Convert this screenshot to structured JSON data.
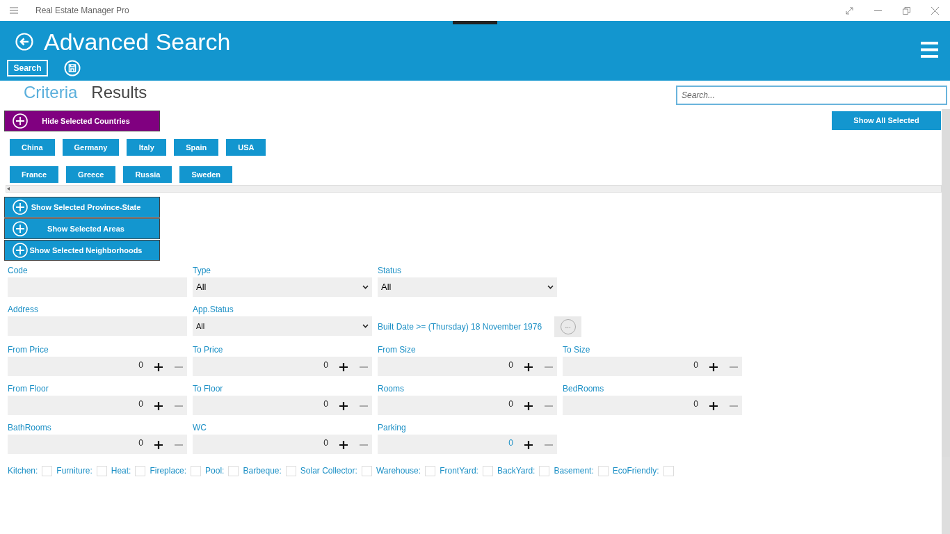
{
  "window": {
    "title": "Real Estate Manager Pro"
  },
  "header": {
    "title": "Advanced Search",
    "search_button": "Search"
  },
  "tabs": [
    {
      "label": "Criteria",
      "selected": true
    },
    {
      "label": "Results",
      "selected": false
    }
  ],
  "search": {
    "placeholder": "Search..."
  },
  "show_all_button": "Show All Selected",
  "country_toggle": {
    "label": "Hide Selected Countries",
    "expanded": true
  },
  "countries": [
    [
      "China",
      "Germany",
      "Italy",
      "Spain",
      "USA"
    ],
    [
      "France",
      "Greece",
      "Russia",
      "Sweden"
    ]
  ],
  "toggles": [
    {
      "label": "Show Selected Province-State",
      "expanded": false
    },
    {
      "label": "Show Selected Areas",
      "expanded": false
    },
    {
      "label": "Show Selected Neighborhoods",
      "expanded": false
    }
  ],
  "field_rows": [
    [
      {
        "kind": "text",
        "label": "Code"
      },
      {
        "kind": "select",
        "label": "Type",
        "value": "All"
      },
      {
        "kind": "select",
        "label": "Status",
        "value": "All"
      }
    ],
    [
      {
        "kind": "text",
        "label": "Address"
      },
      {
        "kind": "select",
        "label": "App.Status",
        "value": "All",
        "small": true
      },
      {
        "kind": "date",
        "text": "Built Date >= (Thursday) 18 November 1976",
        "button": "..."
      }
    ],
    [
      {
        "kind": "number",
        "label": "From Price",
        "value": "0",
        "focused": false
      },
      {
        "kind": "number",
        "label": "To Price",
        "value": "0",
        "focused": false
      },
      {
        "kind": "number",
        "label": "From Size",
        "value": "0",
        "focused": false
      },
      {
        "kind": "number",
        "label": "To Size",
        "value": "0",
        "focused": false
      }
    ],
    [
      {
        "kind": "number",
        "label": "From Floor",
        "value": "0",
        "focused": false
      },
      {
        "kind": "number",
        "label": "To Floor",
        "value": "0",
        "focused": false
      },
      {
        "kind": "number",
        "label": "Rooms",
        "value": "0",
        "focused": false
      },
      {
        "kind": "number",
        "label": "BedRooms",
        "value": "0",
        "focused": false
      }
    ],
    [
      {
        "kind": "number",
        "label": "BathRooms",
        "value": "0",
        "focused": false
      },
      {
        "kind": "number",
        "label": "WC",
        "value": "0",
        "focused": false
      },
      {
        "kind": "number",
        "label": "Parking",
        "value": "0",
        "focused": true
      }
    ]
  ],
  "features": [
    {
      "label": "Kitchen:",
      "checked": false
    },
    {
      "label": "Furniture:",
      "checked": false
    },
    {
      "label": "Heat:",
      "checked": false
    },
    {
      "label": "Fireplace:",
      "checked": false
    },
    {
      "label": "Pool:",
      "checked": false
    },
    {
      "label": "Barbeque:",
      "checked": false
    },
    {
      "label": "Solar Collector:",
      "checked": false
    },
    {
      "label": "Warehouse:",
      "checked": false
    },
    {
      "label": "FrontYard:",
      "checked": false
    },
    {
      "label": "BackYard:",
      "checked": false
    },
    {
      "label": "Basement:",
      "checked": false
    },
    {
      "label": "EcoFriendly:",
      "checked": false
    }
  ]
}
